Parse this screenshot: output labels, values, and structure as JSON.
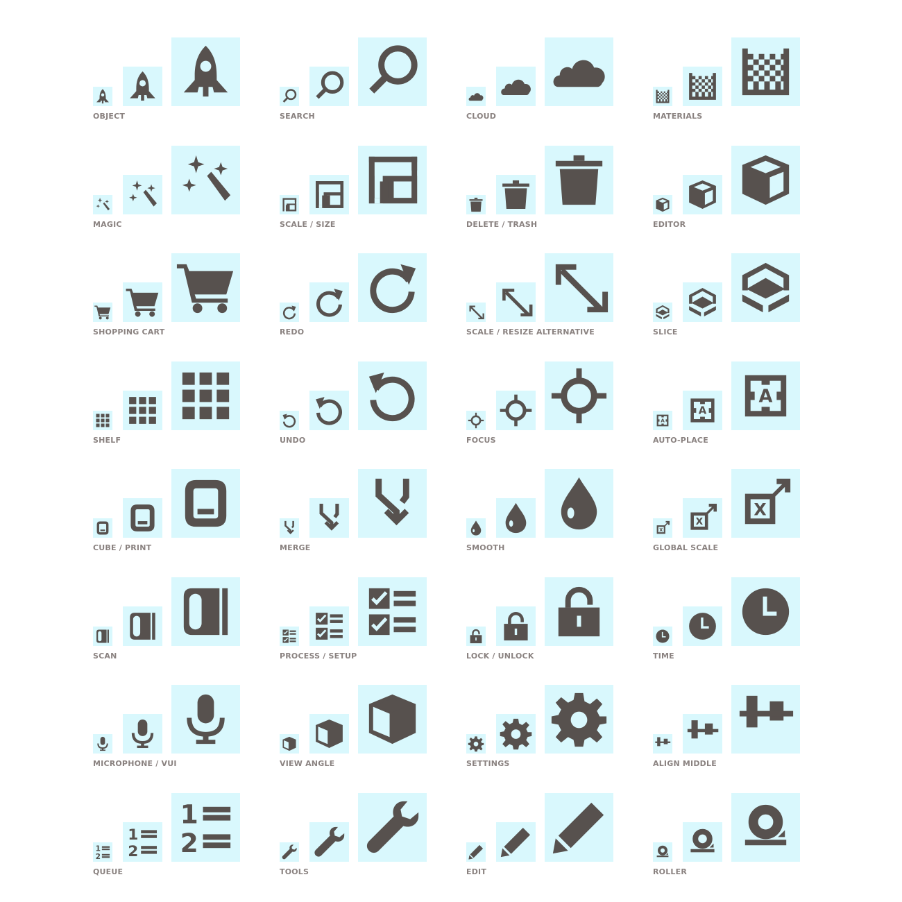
{
  "colors": {
    "tile_background": "#d9f8fd",
    "icon": "#57514e",
    "label": "#8a8280",
    "page_background": "#ffffff"
  },
  "icons": [
    {
      "label": "OBJECT",
      "icon": "rocket-icon"
    },
    {
      "label": "SEARCH",
      "icon": "search-icon"
    },
    {
      "label": "CLOUD",
      "icon": "cloud-icon"
    },
    {
      "label": "MATERIALS",
      "icon": "materials-icon"
    },
    {
      "label": "MAGIC",
      "icon": "magic-wand-icon"
    },
    {
      "label": "SCALE / SIZE",
      "icon": "scale-size-icon"
    },
    {
      "label": "DELETE / TRASH",
      "icon": "trash-icon"
    },
    {
      "label": "EDITOR",
      "icon": "cube-editor-icon"
    },
    {
      "label": "SHOPPING CART",
      "icon": "shopping-cart-icon"
    },
    {
      "label": "REDO",
      "icon": "redo-icon"
    },
    {
      "label": "SCALE / RESIZE ALTERNATIVE",
      "icon": "resize-diagonal-icon"
    },
    {
      "label": "SLICE",
      "icon": "slice-icon"
    },
    {
      "label": "SHELF",
      "icon": "grid-shelf-icon"
    },
    {
      "label": "UNDO",
      "icon": "undo-icon"
    },
    {
      "label": "FOCUS",
      "icon": "crosshair-focus-icon"
    },
    {
      "label": "AUTO-PLACE",
      "icon": "auto-place-icon"
    },
    {
      "label": "CUBE / PRINT",
      "icon": "cube-print-icon"
    },
    {
      "label": "MERGE",
      "icon": "merge-icon"
    },
    {
      "label": "SMOOTH",
      "icon": "droplet-icon"
    },
    {
      "label": "GLOBAL SCALE",
      "icon": "global-scale-icon"
    },
    {
      "label": "SCAN",
      "icon": "scan-icon"
    },
    {
      "label": "PROCESS / SETUP",
      "icon": "checklist-icon"
    },
    {
      "label": "LOCK / UNLOCK",
      "icon": "lock-open-icon"
    },
    {
      "label": "TIME",
      "icon": "clock-icon"
    },
    {
      "label": "MICROPHONE / VUI",
      "icon": "microphone-icon"
    },
    {
      "label": "VIEW ANGLE",
      "icon": "view-angle-cube-icon"
    },
    {
      "label": "SETTINGS",
      "icon": "gear-icon"
    },
    {
      "label": "ALIGN MIDDLE",
      "icon": "align-middle-icon"
    },
    {
      "label": "QUEUE",
      "icon": "numbered-list-icon"
    },
    {
      "label": "TOOLS",
      "icon": "wrench-icon"
    },
    {
      "label": "EDIT",
      "icon": "pencil-icon"
    },
    {
      "label": "ROLLER",
      "icon": "roller-icon"
    }
  ]
}
